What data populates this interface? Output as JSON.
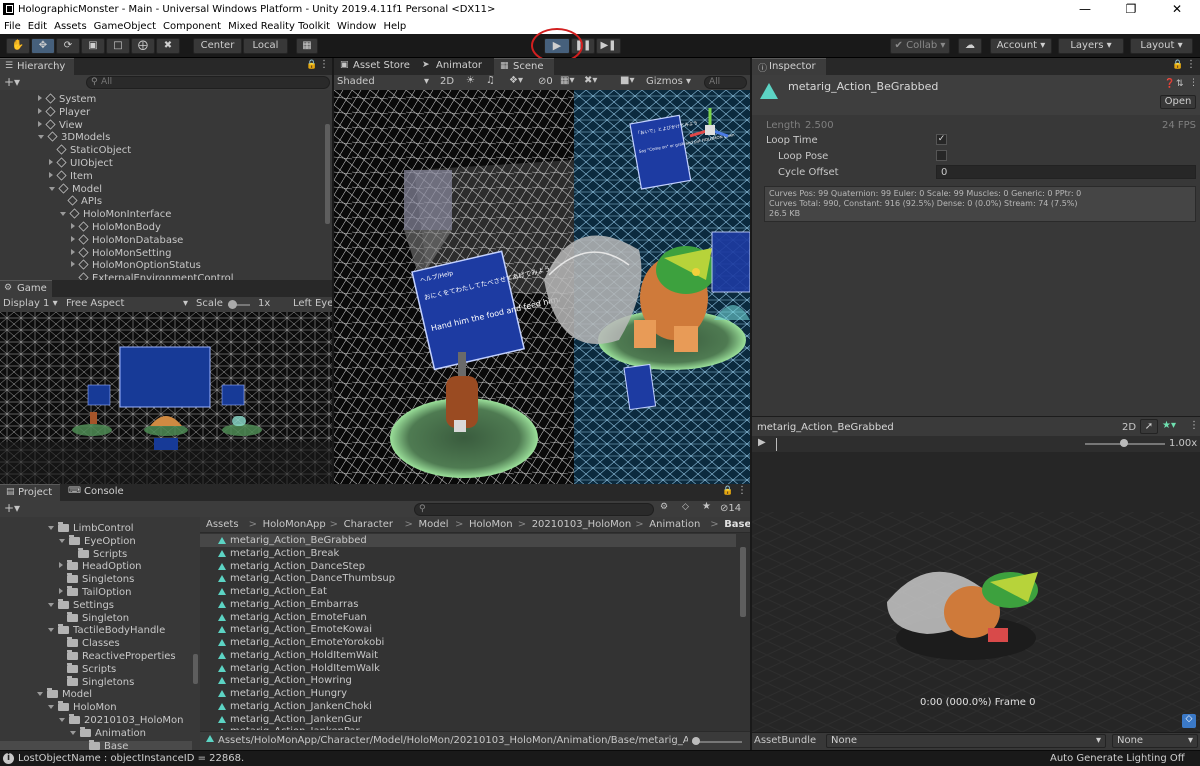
{
  "window": {
    "title": "HolographicMonster - Main - Universal Windows Platform - Unity 2019.4.11f1 Personal <DX11>"
  },
  "menu": [
    "File",
    "Edit",
    "Assets",
    "GameObject",
    "Component",
    "Mixed Reality Toolkit",
    "Window",
    "Help"
  ],
  "toolbar": {
    "center_label": "Center",
    "local_label": "Local",
    "collab_label": "Collab",
    "account_label": "Account",
    "layers_label": "Layers",
    "layout_label": "Layout"
  },
  "hierarchy": {
    "title": "Hierarchy",
    "search_placeholder": "All",
    "items": [
      {
        "label": "System",
        "indent": 0,
        "icon": "cube",
        "exp": "right"
      },
      {
        "label": "Player",
        "indent": 0,
        "icon": "cube",
        "exp": "right"
      },
      {
        "label": "View",
        "indent": 0,
        "icon": "cube",
        "exp": "right"
      },
      {
        "label": "3DModels",
        "indent": 0,
        "icon": "cube",
        "exp": "down"
      },
      {
        "label": "StaticObject",
        "indent": 1,
        "icon": "cube",
        "exp": ""
      },
      {
        "label": "UIObject",
        "indent": 1,
        "icon": "cube",
        "exp": "right"
      },
      {
        "label": "Item",
        "indent": 1,
        "icon": "cube",
        "exp": "right"
      },
      {
        "label": "Model",
        "indent": 1,
        "icon": "cube",
        "exp": "down"
      },
      {
        "label": "APIs",
        "indent": 2,
        "icon": "cube",
        "exp": ""
      },
      {
        "label": "HoloMonInterface",
        "indent": 2,
        "icon": "cube",
        "exp": "down"
      },
      {
        "label": "HoloMonBody",
        "indent": 3,
        "icon": "cube",
        "exp": "right"
      },
      {
        "label": "HoloMonDatabase",
        "indent": 3,
        "icon": "cube",
        "exp": "right"
      },
      {
        "label": "HoloMonSetting",
        "indent": 3,
        "icon": "cube",
        "exp": "right"
      },
      {
        "label": "HoloMonOptionStatus",
        "indent": 3,
        "icon": "cube",
        "exp": "right"
      },
      {
        "label": "ExternalEnvironmentControl",
        "indent": 3,
        "icon": "cube",
        "exp": ""
      }
    ]
  },
  "game": {
    "title": "Game",
    "display": "Display 1",
    "aspect": "Free Aspect",
    "scale_label": "Scale",
    "scale_value": "1x",
    "eye": "Left Eye"
  },
  "scene": {
    "tabs": [
      "Asset Store",
      "Animator",
      "Scene"
    ],
    "shading": "Shaded",
    "mode2d": "2D",
    "gizmos": "Gizmos",
    "search_placeholder": "All",
    "layer_count": "0",
    "signs": {
      "left_title": "ヘルプ/Help",
      "left_jp": "おにくをてわたしてたべさせてあげてみよう",
      "left_en": "Hand him the food and feed him.",
      "right_en": "Say \"Come on\" or grab and put HOLOMON down",
      "right_jp": "「おいで」とよびかけてみよう"
    }
  },
  "inspector": {
    "title": "Inspector",
    "asset_name": "metarig_Action_BeGrabbed",
    "open_label": "Open",
    "length_label": "Length",
    "length_value": "2.500",
    "fps": "24 FPS",
    "loop_time_label": "Loop Time",
    "loop_time_checked": true,
    "loop_pose_label": "Loop Pose",
    "loop_pose_checked": false,
    "cycle_offset_label": "Cycle Offset",
    "cycle_offset_value": "0",
    "info": [
      "Curves Pos: 99 Quaternion: 99 Euler: 0 Scale: 99 Muscles: 0 Generic: 0 PPtr: 0",
      "Curves Total: 990, Constant: 916 (92.5%) Dense: 0 (0.0%) Stream: 74 (7.5%)",
      "26.5 KB"
    ]
  },
  "preview": {
    "title": "metarig_Action_BeGrabbed",
    "mode2d": "2D",
    "speed": "1.00x",
    "frame": "0:00 (000.0%) Frame 0"
  },
  "assetbundle": {
    "label": "AssetBundle",
    "value1": "None",
    "value2": "None"
  },
  "project": {
    "tabs": [
      "Project",
      "Console"
    ],
    "count": "14",
    "tree": [
      {
        "label": "LimbControl",
        "indent": 0,
        "exp": "down"
      },
      {
        "label": "EyeOption",
        "indent": 1,
        "exp": "down"
      },
      {
        "label": "Scripts",
        "indent": 2,
        "exp": ""
      },
      {
        "label": "HeadOption",
        "indent": 1,
        "exp": "right"
      },
      {
        "label": "Singletons",
        "indent": 1,
        "exp": ""
      },
      {
        "label": "TailOption",
        "indent": 1,
        "exp": "right"
      },
      {
        "label": "Settings",
        "indent": 0,
        "exp": "down"
      },
      {
        "label": "Singleton",
        "indent": 1,
        "exp": ""
      },
      {
        "label": "TactileBodyHandle",
        "indent": 0,
        "exp": "down"
      },
      {
        "label": "Classes",
        "indent": 1,
        "exp": ""
      },
      {
        "label": "ReactiveProperties",
        "indent": 1,
        "exp": ""
      },
      {
        "label": "Scripts",
        "indent": 1,
        "exp": ""
      },
      {
        "label": "Singletons",
        "indent": 1,
        "exp": ""
      },
      {
        "label": "Model",
        "indent": -1,
        "exp": "down"
      },
      {
        "label": "HoloMon",
        "indent": 0,
        "exp": "down"
      },
      {
        "label": "20210103_HoloMon",
        "indent": 1,
        "exp": "down"
      },
      {
        "label": "Animation",
        "indent": 2,
        "exp": "down"
      },
      {
        "label": "Base",
        "indent": 3,
        "exp": "",
        "selected": true
      }
    ],
    "breadcrumb": [
      "Assets",
      "HoloMonApp",
      "Character",
      "Model",
      "HoloMon",
      "20210103_HoloMon",
      "Animation",
      "Base"
    ],
    "files": [
      "metarig_Action_BeGrabbed",
      "metarig_Action_Break",
      "metarig_Action_DanceStep",
      "metarig_Action_DanceThumbsup",
      "metarig_Action_Eat",
      "metarig_Action_Embarras",
      "metarig_Action_EmoteFuan",
      "metarig_Action_EmoteKowai",
      "metarig_Action_EmoteYorokobi",
      "metarig_Action_HoldItemWait",
      "metarig_Action_HoldItemWalk",
      "metarig_Action_Howring",
      "metarig_Action_Hungry",
      "metarig_Action_JankenChoki",
      "metarig_Action_JankenGur",
      "metarig_Action_JankenPar"
    ],
    "path": "Assets/HoloMonApp/Character/Model/HoloMon/20210103_HoloMon/Animation/Base/metarig_Action_B"
  },
  "status": {
    "message": "LostObjectName : objectInstanceID = 22868.",
    "lighting": "Auto Generate Lighting Off"
  }
}
